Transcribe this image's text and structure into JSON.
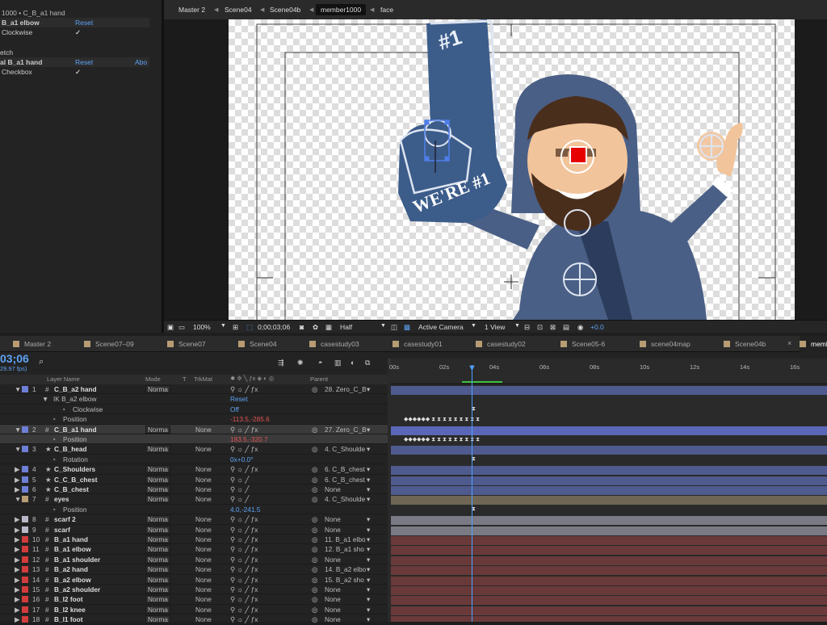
{
  "effects_panel": {
    "title": "1000 • C_B_a1 hand",
    "rows": [
      {
        "label": "B_a1 elbow",
        "link": "Reset",
        "link2": ""
      },
      {
        "label": "Clockwise",
        "check": "✓"
      },
      {
        "label": "etch"
      },
      {
        "label": "al B_a1 hand",
        "link": "Reset",
        "link2": "Abo"
      },
      {
        "label": "Checkbox",
        "check": "✓"
      }
    ]
  },
  "comp_tabs": [
    "Master 2",
    "Scene04",
    "Scene04b",
    "member1000",
    "face"
  ],
  "foam_finger_text": {
    "num": "#1",
    "were": "WE'RE #1"
  },
  "comp_bar": {
    "zoom": "100%",
    "timecode": "0;00;03;06",
    "resolution": "Half",
    "camera": "Active Camera",
    "views": "1 View",
    "exposure": "+0.0"
  },
  "timeline_tabs": [
    "Master 2",
    "Scene07–09",
    "Scene07",
    "Scene04",
    "casestudy03",
    "casestudy01",
    "casestudy02",
    "Scene05-6",
    "scene04map",
    "Scene04b",
    "memb"
  ],
  "timeline_head": {
    "timecode": "03;06",
    "fps": "29.97 fps)",
    "search": "⌕"
  },
  "layer_header": {
    "layer_name": "Layer Name",
    "mode": "Mode",
    "t": "T",
    "trkmat": "TrkMat",
    "parent": "Parent"
  },
  "ruler": [
    "00s",
    "02s",
    "04s",
    "06s",
    "08s",
    "10s",
    "12s",
    "14s",
    "16s"
  ],
  "layers": [
    {
      "type": "layer",
      "num": "1",
      "name": "C_B_a2 hand",
      "color": "#6e7fd6",
      "mode": "Norma",
      "trk": "",
      "parent": "28. Zero_C_B",
      "fx": true
    },
    {
      "type": "prop",
      "name": "IK B_a2 elbow",
      "value": "Reset",
      "vclass": "valb",
      "indent": 1
    },
    {
      "type": "prop",
      "name": "Clockwise",
      "value": "Off",
      "vclass": "valb",
      "indent": 3
    },
    {
      "type": "prop",
      "name": "Position",
      "value": "-113.5,-285.6",
      "vclass": "val",
      "indent": 2
    },
    {
      "type": "layer",
      "num": "2",
      "name": "C_B_a1 hand",
      "color": "#6e7fd6",
      "mode": "Norma",
      "trk": "None",
      "parent": "27. Zero_C_B",
      "fx": true,
      "selected": true
    },
    {
      "type": "prop",
      "name": "Position",
      "value": "183.5,-320.7",
      "vclass": "val",
      "indent": 2,
      "selected": true
    },
    {
      "type": "layer",
      "num": "3",
      "name": "C_B_head",
      "color": "#6e7fd6",
      "mode": "Norma",
      "trk": "None",
      "parent": "4. C_Shoulde",
      "fx": true
    },
    {
      "type": "prop",
      "name": "Rotation",
      "value": "0x+0.0°",
      "vclass": "valb",
      "indent": 2
    },
    {
      "type": "layer",
      "num": "4",
      "name": "C_Shoulders",
      "color": "#6e7fd6",
      "mode": "Norma",
      "trk": "None",
      "parent": "6. C_B_chest",
      "fx": true
    },
    {
      "type": "layer",
      "num": "5",
      "name": "C_C_B_chest",
      "color": "#6e7fd6",
      "mode": "Norma",
      "trk": "None",
      "parent": "6. C_B_chest",
      "fx": false
    },
    {
      "type": "layer",
      "num": "6",
      "name": "C_B_chest",
      "color": "#6e7fd6",
      "mode": "Norma",
      "trk": "None",
      "parent": "None",
      "fx": false
    },
    {
      "type": "layer",
      "num": "7",
      "name": "eyes",
      "color": "#b79c74",
      "mode": "Norma",
      "trk": "None",
      "parent": "4. C_Shoulde",
      "fx": false
    },
    {
      "type": "prop",
      "name": "Position",
      "value": "4.0,-241.5",
      "vclass": "valb",
      "indent": 2
    },
    {
      "type": "layer",
      "num": "8",
      "name": "scarf 2",
      "color": "#b8b8c8",
      "mode": "Norma",
      "trk": "None",
      "parent": "None",
      "fx": true
    },
    {
      "type": "layer",
      "num": "9",
      "name": "scarf",
      "color": "#b8b8c8",
      "mode": "Norma",
      "trk": "None",
      "parent": "None",
      "fx": true
    },
    {
      "type": "layer",
      "num": "10",
      "name": "B_a1 hand",
      "color": "#d23c3c",
      "mode": "Norma",
      "trk": "None",
      "parent": "11. B_a1 elbo",
      "fx": true
    },
    {
      "type": "layer",
      "num": "11",
      "name": "B_a1 elbow",
      "color": "#d23c3c",
      "mode": "Norma",
      "trk": "None",
      "parent": "12. B_a1 sho",
      "fx": true
    },
    {
      "type": "layer",
      "num": "12",
      "name": "B_a1 shoulder",
      "color": "#d23c3c",
      "mode": "Norma",
      "trk": "None",
      "parent": "None",
      "fx": true
    },
    {
      "type": "layer",
      "num": "13",
      "name": "B_a2 hand",
      "color": "#d23c3c",
      "mode": "Norma",
      "trk": "None",
      "parent": "14. B_a2 elbo",
      "fx": true
    },
    {
      "type": "layer",
      "num": "14",
      "name": "B_a2 elbow",
      "color": "#d23c3c",
      "mode": "Norma",
      "trk": "None",
      "parent": "15. B_a2 sho",
      "fx": true
    },
    {
      "type": "layer",
      "num": "15",
      "name": "B_a2 shoulder",
      "color": "#d23c3c",
      "mode": "Norma",
      "trk": "None",
      "parent": "None",
      "fx": true
    },
    {
      "type": "layer",
      "num": "16",
      "name": "B_l2 foot",
      "color": "#d23c3c",
      "mode": "Norma",
      "trk": "None",
      "parent": "None",
      "fx": true
    },
    {
      "type": "layer",
      "num": "17",
      "name": "B_l2 knee",
      "color": "#d23c3c",
      "mode": "Norma",
      "trk": "None",
      "parent": "None",
      "fx": true
    },
    {
      "type": "layer",
      "num": "18",
      "name": "B_l1 foot",
      "color": "#d23c3c",
      "mode": "Norma",
      "trk": "None",
      "parent": "None",
      "fx": true
    }
  ],
  "colors": {
    "accent": "#4ea0ff",
    "hood": "#4a5f85",
    "skin": "#f2c49b",
    "hair": "#4a2e1c",
    "finger": "#3c5c8a"
  }
}
